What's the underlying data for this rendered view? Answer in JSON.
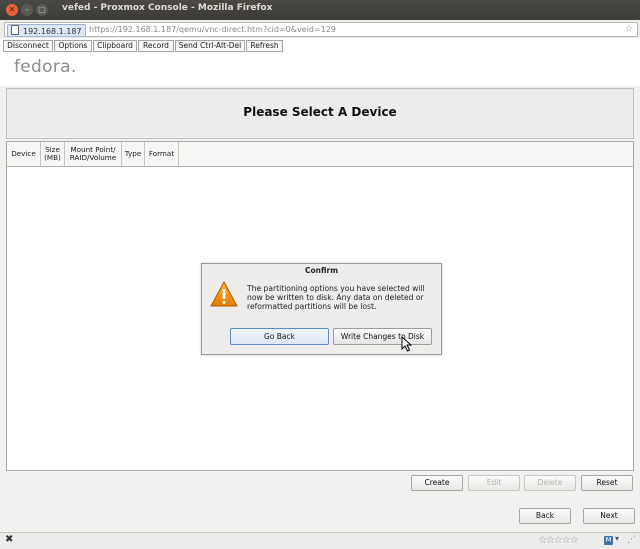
{
  "window": {
    "title": "vefed - Proxmox Console - Mozilla Firefox"
  },
  "browser": {
    "site_badge": "192.168.1.187",
    "url": "https://192.168.1.187/qemu/vnc-direct.htm?cid=0&veid=129"
  },
  "toolbar": {
    "buttons": [
      "Disconnect",
      "Options",
      "Clipboard",
      "Record",
      "Send Ctrl-Alt-Del",
      "Refresh"
    ]
  },
  "installer": {
    "logo": "fedora.",
    "heading": "Please Select A Device",
    "columns": [
      {
        "line1": "Device",
        "line2": ""
      },
      {
        "line1": "Size",
        "line2": "(MB)"
      },
      {
        "line1": "Mount Point/",
        "line2": "RAID/Volume"
      },
      {
        "line1": "Type",
        "line2": ""
      },
      {
        "line1": "Format",
        "line2": ""
      }
    ],
    "actions": {
      "create": "Create",
      "edit": "Edit",
      "delete": "Delete",
      "reset": "Reset"
    },
    "nav": {
      "back": "Back",
      "next": "Next"
    }
  },
  "dialog": {
    "title": "Confirm",
    "message_lines": [
      "The partitioning options you have selected will",
      "now be written to disk.  Any data on deleted or",
      "reformatted partitions will be lost."
    ],
    "go_back": "Go Back",
    "write": "Write Changes to Disk",
    "icon": "warning-icon"
  },
  "statusbar": {
    "close_glyph": "✖",
    "rating_glyphs": "☆☆☆☆☆",
    "addon_glyph": "M"
  },
  "colors": {
    "accent_blue": "#5d88c7",
    "warning_orange": "#e8a000",
    "close_button": "#e8613a"
  }
}
